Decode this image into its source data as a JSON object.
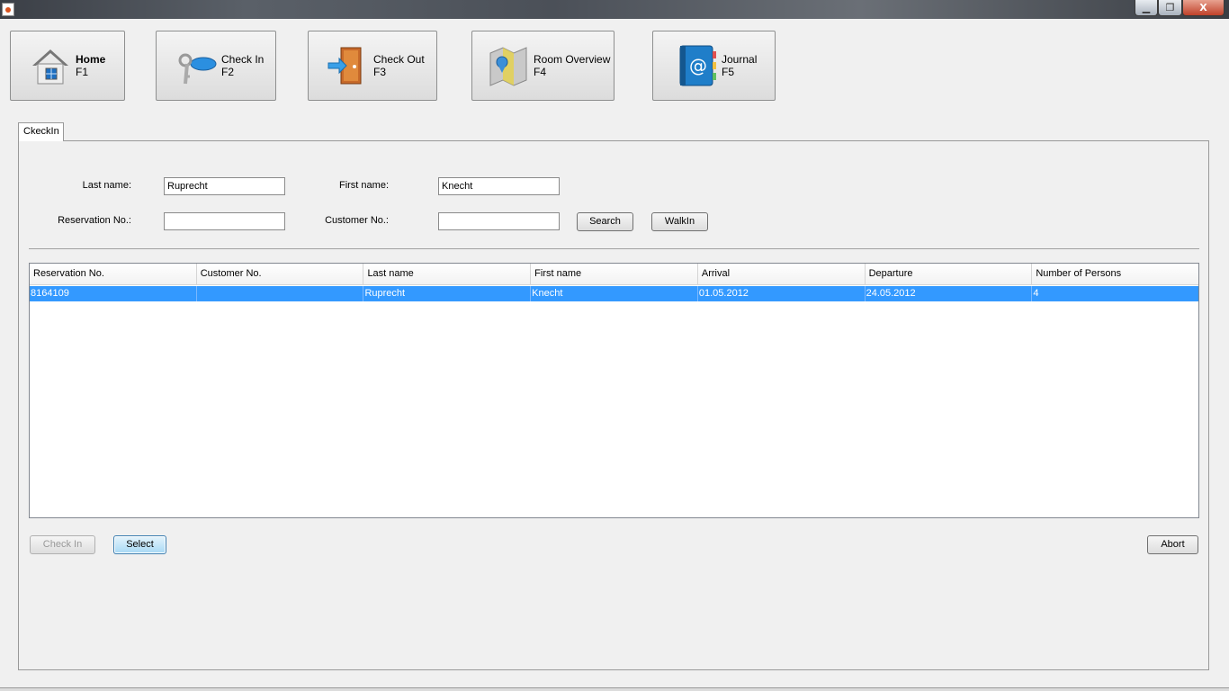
{
  "window": {
    "min_symbol": "▁",
    "max_symbol": "❐",
    "close_symbol": "X"
  },
  "nav": [
    {
      "label": "Home",
      "key": "F1",
      "icon": "house-icon"
    },
    {
      "label": "Check In",
      "key": "F2",
      "icon": "key-icon"
    },
    {
      "label": "Check Out",
      "key": "F3",
      "icon": "door-exit-icon"
    },
    {
      "label": "Room Overview",
      "key": "F4",
      "icon": "map-icon"
    },
    {
      "label": "Journal",
      "key": "F5",
      "icon": "address-book-icon"
    }
  ],
  "tab": {
    "label": "CkeckIn"
  },
  "form": {
    "last_name_label": "Last name:",
    "last_name_value": "Ruprecht",
    "first_name_label": "First name:",
    "first_name_value": "Knecht",
    "reservation_label": "Reservation No.:",
    "reservation_value": "",
    "customer_label": "Customer No.:",
    "customer_value": "",
    "search_label": "Search",
    "walkin_label": "WalkIn"
  },
  "table": {
    "columns": [
      "Reservation No.",
      "Customer No.",
      "Last name",
      "First name",
      "Arrival",
      "Departure",
      "Number of Persons"
    ],
    "rows": [
      [
        "8164109",
        "",
        "Ruprecht",
        "Knecht",
        "01.05.2012",
        "24.05.2012",
        "4"
      ]
    ]
  },
  "actions": {
    "checkin_label": "Check In",
    "select_label": "Select",
    "abort_label": "Abort"
  },
  "colors": {
    "selection": "#3399ff",
    "accent": "#3c7fb1"
  }
}
